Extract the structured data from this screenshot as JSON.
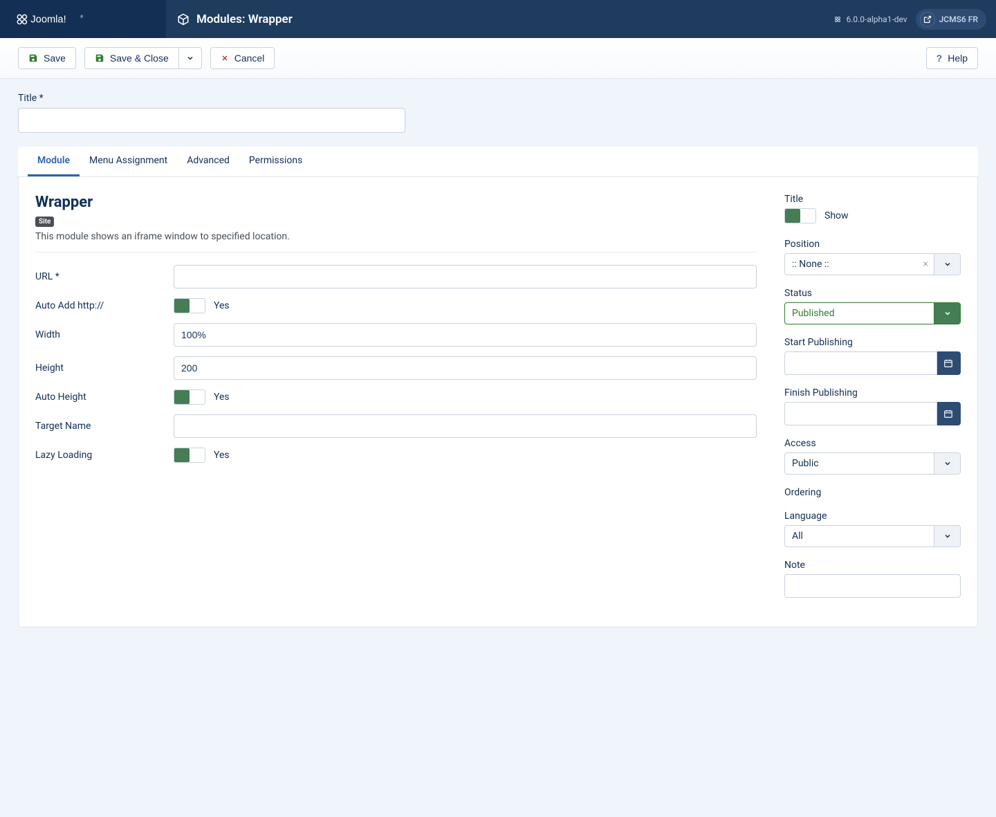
{
  "header": {
    "page_title": "Modules: Wrapper",
    "version": "6.0.0-alpha1-dev",
    "site_name": "JCMS6 FR"
  },
  "toolbar": {
    "save": "Save",
    "save_close": "Save & Close",
    "cancel": "Cancel",
    "help": "Help"
  },
  "title_field": {
    "label": "Title *",
    "value": ""
  },
  "tabs": [
    {
      "key": "module",
      "label": "Module",
      "active": true
    },
    {
      "key": "menu",
      "label": "Menu Assignment",
      "active": false
    },
    {
      "key": "advanced",
      "label": "Advanced",
      "active": false
    },
    {
      "key": "permissions",
      "label": "Permissions",
      "active": false
    }
  ],
  "module": {
    "heading": "Wrapper",
    "badge": "Site",
    "description": "This module shows an iframe window to specified location.",
    "fields": {
      "url": {
        "label": "URL *",
        "value": ""
      },
      "auto_add_http": {
        "label": "Auto Add http://",
        "value": "Yes"
      },
      "width": {
        "label": "Width",
        "value": "100%"
      },
      "height": {
        "label": "Height",
        "value": "200"
      },
      "auto_height": {
        "label": "Auto Height",
        "value": "Yes"
      },
      "target_name": {
        "label": "Target Name",
        "value": ""
      },
      "lazy_loading": {
        "label": "Lazy Loading",
        "value": "Yes"
      }
    }
  },
  "sidebar": {
    "title": {
      "label": "Title",
      "value": "Show"
    },
    "position": {
      "label": "Position",
      "value": ":: None ::"
    },
    "status": {
      "label": "Status",
      "value": "Published"
    },
    "start_pub": {
      "label": "Start Publishing",
      "value": ""
    },
    "finish_pub": {
      "label": "Finish Publishing",
      "value": ""
    },
    "access": {
      "label": "Access",
      "value": "Public"
    },
    "ordering": {
      "label": "Ordering"
    },
    "language": {
      "label": "Language",
      "value": "All"
    },
    "note": {
      "label": "Note",
      "value": ""
    }
  }
}
